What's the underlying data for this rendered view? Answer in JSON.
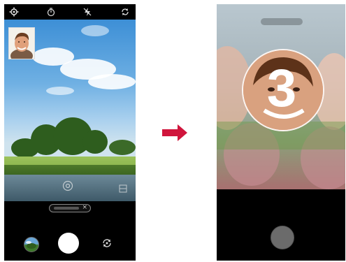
{
  "left_screen": {
    "top_icons": [
      "settings-icon",
      "timer-icon",
      "flash-off-icon",
      "switch-camera-icon"
    ],
    "countdown_pill_close": "×"
  },
  "right_screen": {
    "countdown": "3"
  },
  "colors": {
    "arrow": "#d0153c",
    "shutter_left": "#ffffff",
    "shutter_right": "#6b6b6b",
    "background": "#ffffff"
  }
}
